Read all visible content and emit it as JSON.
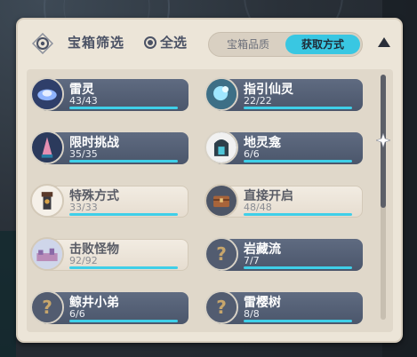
{
  "header": {
    "title": "宝箱筛选",
    "select_all": "全选",
    "select_all_checked": true,
    "tabs": [
      {
        "label": "宝箱品质",
        "active": false
      },
      {
        "label": "获取方式",
        "active": true
      }
    ]
  },
  "items": [
    {
      "name": "雷灵",
      "count": "43/43",
      "progress": 1.0,
      "style": "dark",
      "icon": "electro-seelie-icon"
    },
    {
      "name": "指引仙灵",
      "count": "22/22",
      "progress": 1.0,
      "style": "dark",
      "icon": "guiding-seelie-icon"
    },
    {
      "name": "限时挑战",
      "count": "35/35",
      "progress": 1.0,
      "style": "dark",
      "icon": "time-trial-icon"
    },
    {
      "name": "地灵龛",
      "count": "6/6",
      "progress": 1.0,
      "style": "dark",
      "icon": "shrine-icon"
    },
    {
      "name": "特殊方式",
      "count": "33/33",
      "progress": 1.0,
      "style": "light",
      "icon": "special-method-icon"
    },
    {
      "name": "直接开启",
      "count": "48/48",
      "progress": 1.0,
      "style": "light",
      "icon": "chest-icon"
    },
    {
      "name": "击败怪物",
      "count": "92/92",
      "progress": 1.0,
      "style": "light",
      "icon": "defeat-monsters-icon"
    },
    {
      "name": "岩藏流",
      "count": "7/7",
      "progress": 1.0,
      "style": "dark",
      "icon": "question-mark-icon"
    },
    {
      "name": "鲸井小弟",
      "count": "6/6",
      "progress": 1.0,
      "style": "dark",
      "icon": "question-mark-icon"
    },
    {
      "name": "雷樱树",
      "count": "8/8",
      "progress": 1.0,
      "style": "dark",
      "icon": "question-mark-icon"
    }
  ],
  "colors": {
    "accent": "#39c7e2",
    "panel": "#ece5d8",
    "card_dark": "#4f5a6f",
    "progress_fill": "#3fcfe8"
  }
}
